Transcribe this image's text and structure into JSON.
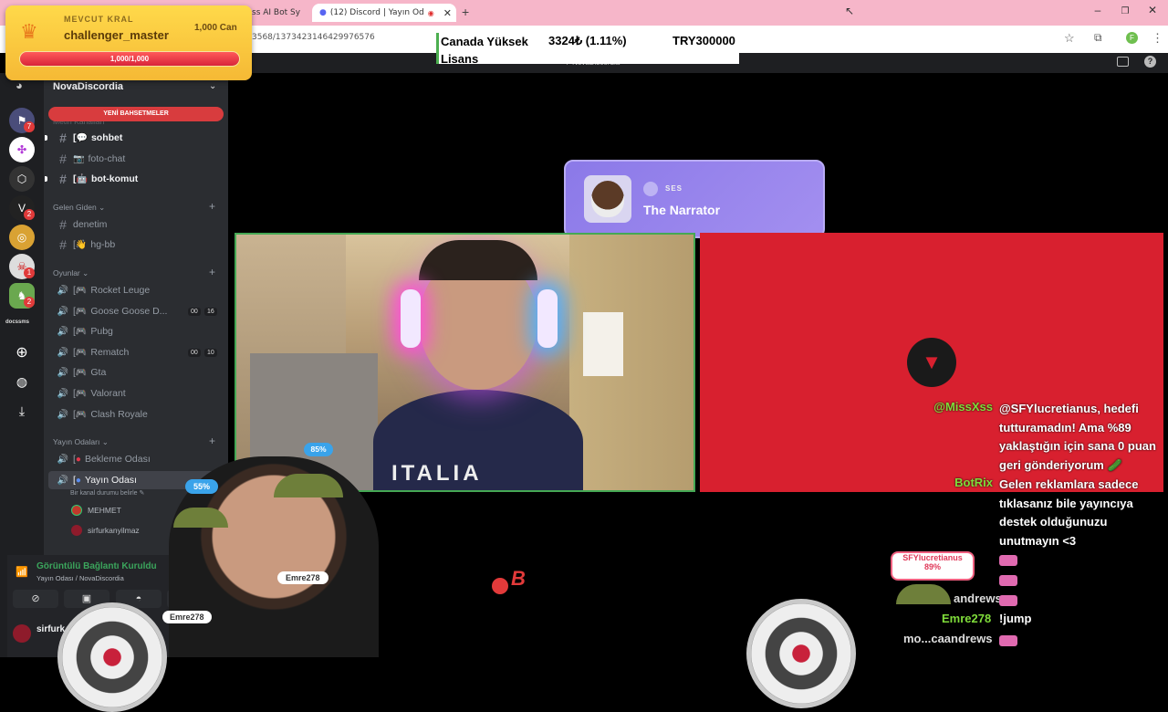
{
  "browser": {
    "tabs": [
      {
        "label": "ss AI Bot Sy"
      },
      {
        "label": "(12) Discord | Yayın Od"
      }
    ],
    "url": "3568/1373423146429976576"
  },
  "ticker": {
    "name": "Canada Yüksek Lisans",
    "change": "3324₺ (1.11%)",
    "total": "TRY300000"
  },
  "discord_top": {
    "title": "NovaDiscordia"
  },
  "king": {
    "label": "MEVCUT KRAL",
    "username": "challenger_master",
    "hp": "1,000 Can",
    "bar": "1,000/1,000",
    "bar_fill": 1.0
  },
  "server_rail": {
    "logo_text": "docssms",
    "badges": [
      "7",
      "2",
      "1",
      "2"
    ]
  },
  "sidebar": {
    "server_name": "NovaDiscordia",
    "new_mentions": "YENİ BAHSETMELER",
    "faded_category": "Metin Kanalları",
    "text_channels": [
      {
        "prefix": "[",
        "emoji": "💬",
        "name": "sohbet",
        "bold": true
      },
      {
        "prefix": "",
        "emoji": "📷",
        "name": "foto-chat",
        "bold": false
      },
      {
        "prefix": "[",
        "emoji": "🤖",
        "name": "bot-komut",
        "bold": true
      }
    ],
    "cat_gelen": "Gelen Giden",
    "gelen_channels": [
      {
        "prefix": "",
        "emoji": "",
        "name": "denetim"
      },
      {
        "prefix": "[",
        "emoji": "👋",
        "name": "hg-bb"
      }
    ],
    "cat_oyunlar": "Oyunlar",
    "game_channels": [
      {
        "name": "Rocket Leuge",
        "count": ""
      },
      {
        "name": "Goose Goose D...",
        "count": "00",
        "count2": "16"
      },
      {
        "name": "Pubg",
        "count": ""
      },
      {
        "name": "Rematch",
        "count": "00",
        "count2": "10"
      },
      {
        "name": "Gta",
        "count": ""
      },
      {
        "name": "Valorant",
        "count": ""
      },
      {
        "name": "Clash Royale",
        "count": ""
      }
    ],
    "cat_yayin": "Yayın Odaları",
    "yayin_channels": [
      {
        "name": "Bekleme Odası"
      },
      {
        "name": "Yayın Odası"
      }
    ],
    "status_text": "Bir kanal durumu belirle",
    "users": [
      "MEHMET",
      "sirfurkanyilmaz"
    ],
    "voice_status": "Görüntülü Bağlantı Kuruldu",
    "voice_channel": "Yayın Odası / NovaDiscordia",
    "account_name": "sirfurk"
  },
  "cam": {
    "volume_badge": "85%"
  },
  "cam2_badge": "55%",
  "narrator": {
    "tag": "SES",
    "name": "The Narrator"
  },
  "chat": [
    {
      "user": "@MissXss",
      "color": "#7fdc3a",
      "lines": [
        "@SFYlucretianus, hedefi",
        "tutturamadın! Ama %89",
        "yaklaştığın için sana 0 puan",
        "geri gönderiyorum 🥒"
      ]
    },
    {
      "user": "BotRix",
      "color": "#7fdc3a",
      "lines": [
        "Gelen reklamlara sadece",
        "tıklasanız bile yayıncıya",
        "destek olduğunuzu",
        "unutmayın <3"
      ]
    }
  ],
  "game_overlay": {
    "sfy_name": "SFYlucretianus",
    "sfy_pct": "89%",
    "players": [
      "Emre278",
      "Emre278"
    ],
    "feed": [
      {
        "user": "andrews",
        "msg": ""
      },
      {
        "user": "Emre278",
        "msg": "!jump"
      },
      {
        "user": "mo...caandrews",
        "msg": ""
      }
    ],
    "b_letter": "B"
  }
}
